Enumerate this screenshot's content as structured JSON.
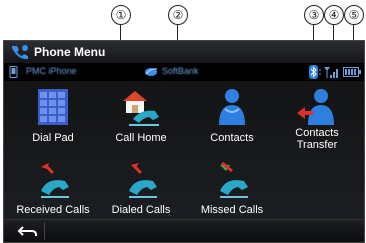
{
  "callouts": [
    "①",
    "②",
    "③",
    "④",
    "⑤"
  ],
  "header": {
    "title": "Phone Menu"
  },
  "status": {
    "device_name": "PMC iPhone",
    "carrier": "SoftBank"
  },
  "menu": [
    {
      "label": "Dial Pad"
    },
    {
      "label": "Call Home"
    },
    {
      "label": "Contacts"
    },
    {
      "label_line1": "Contacts",
      "label_line2": "Transfer"
    },
    {
      "label": "Received Calls"
    },
    {
      "label": "Dialed Calls"
    },
    {
      "label": "Missed Calls"
    }
  ],
  "colors": {
    "accent": "#2f7fe0",
    "status_text": "#6e9cdc",
    "background": "#111111"
  }
}
